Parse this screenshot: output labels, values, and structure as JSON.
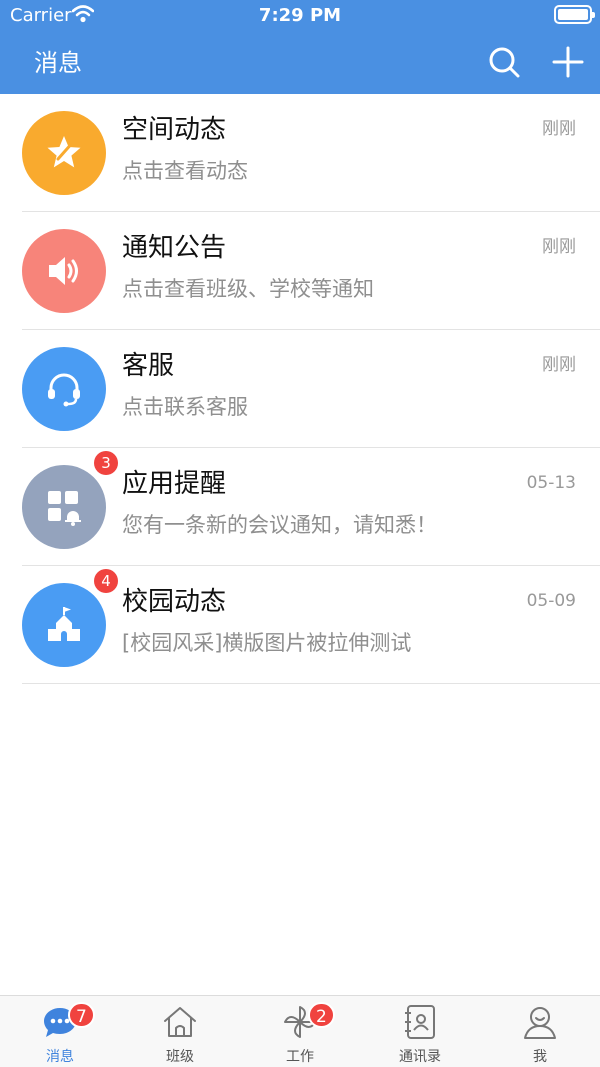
{
  "status_bar": {
    "carrier": "Carrier",
    "time": "7:29 PM"
  },
  "navbar": {
    "title": "消息",
    "search_icon": "search-icon",
    "add_icon": "plus-icon"
  },
  "colors": {
    "primary": "#4a90e2",
    "space": "#f9aa2e",
    "notice": "#f7847a",
    "service": "#4a9cf3",
    "app": "#94a3bd",
    "campus": "#4a9cf3",
    "badge": "#f0433f"
  },
  "messages": [
    {
      "title": "空间动态",
      "subtitle": "点击查看动态",
      "time": "刚刚",
      "icon": "star-icon"
    },
    {
      "title": "通知公告",
      "subtitle": "点击查看班级、学校等通知",
      "time": "刚刚",
      "icon": "speaker-icon"
    },
    {
      "title": "客服",
      "subtitle": "点击联系客服",
      "time": "刚刚",
      "icon": "headset-icon"
    },
    {
      "title": "应用提醒",
      "subtitle": "您有一条新的会议通知，请知悉！",
      "time": "05-13",
      "badge": "3",
      "icon": "apps-bell-icon"
    },
    {
      "title": "校园动态",
      "subtitle": "[校园风采]横版图片被拉伸测试",
      "time": "05-09",
      "badge": "4",
      "icon": "school-icon"
    }
  ],
  "tabs": [
    {
      "label": "消息",
      "badge": "7",
      "active": true,
      "icon": "chat-icon"
    },
    {
      "label": "班级",
      "icon": "house-icon"
    },
    {
      "label": "工作",
      "badge": "2",
      "icon": "pinwheel-icon"
    },
    {
      "label": "通讯录",
      "icon": "contacts-icon"
    },
    {
      "label": "我",
      "icon": "person-icon"
    }
  ]
}
